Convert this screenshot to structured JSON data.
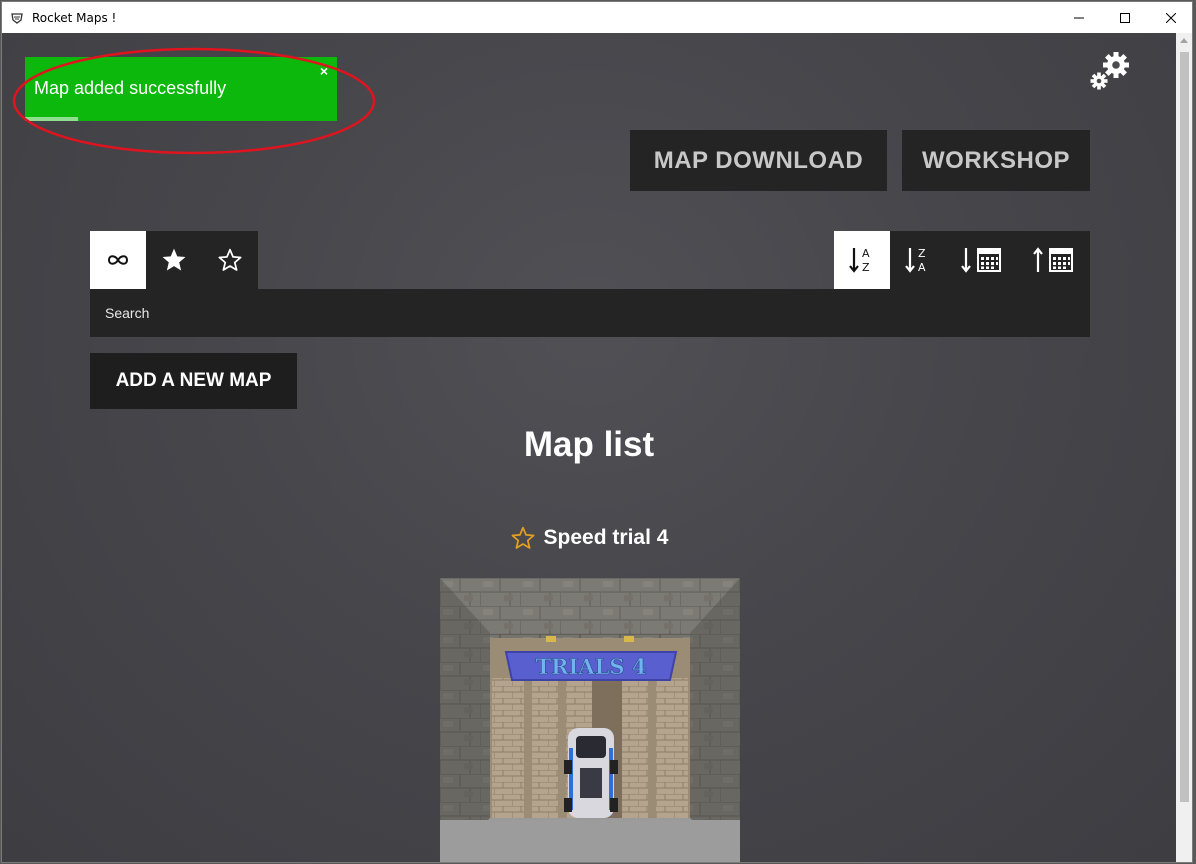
{
  "window": {
    "title": "Rocket Maps !",
    "controls": {
      "minimize": "minimize-icon",
      "maximize": "maximize-icon",
      "close": "close-icon"
    }
  },
  "toast": {
    "message": "Map added successfully",
    "close_label": "×",
    "progress": 0.17,
    "color": "#0bb80b"
  },
  "header": {
    "settings_icon": "gears-icon",
    "map_download_label": "MAP DOWNLOAD",
    "workshop_label": "WORKSHOP"
  },
  "filters": [
    {
      "icon": "infinity-icon",
      "active": true
    },
    {
      "icon": "star-filled-icon",
      "active": false
    },
    {
      "icon": "star-outline-icon",
      "active": false
    }
  ],
  "sort": [
    {
      "icon": "sort-alpha-asc-icon",
      "active": true
    },
    {
      "icon": "sort-alpha-desc-icon",
      "active": false
    },
    {
      "icon": "sort-date-desc-icon",
      "active": false
    },
    {
      "icon": "sort-date-asc-icon",
      "active": false
    }
  ],
  "search": {
    "placeholder": "Search",
    "value": ""
  },
  "add_map_label": "ADD A NEW MAP",
  "page_title": "Map list",
  "maps": [
    {
      "name": "Speed trial 4",
      "favorite": false,
      "banner_text": "TRIALS 4"
    }
  ],
  "colors": {
    "accent_star": "#e3a020",
    "button_bg": "#242424",
    "annotation": "#e0141e"
  }
}
